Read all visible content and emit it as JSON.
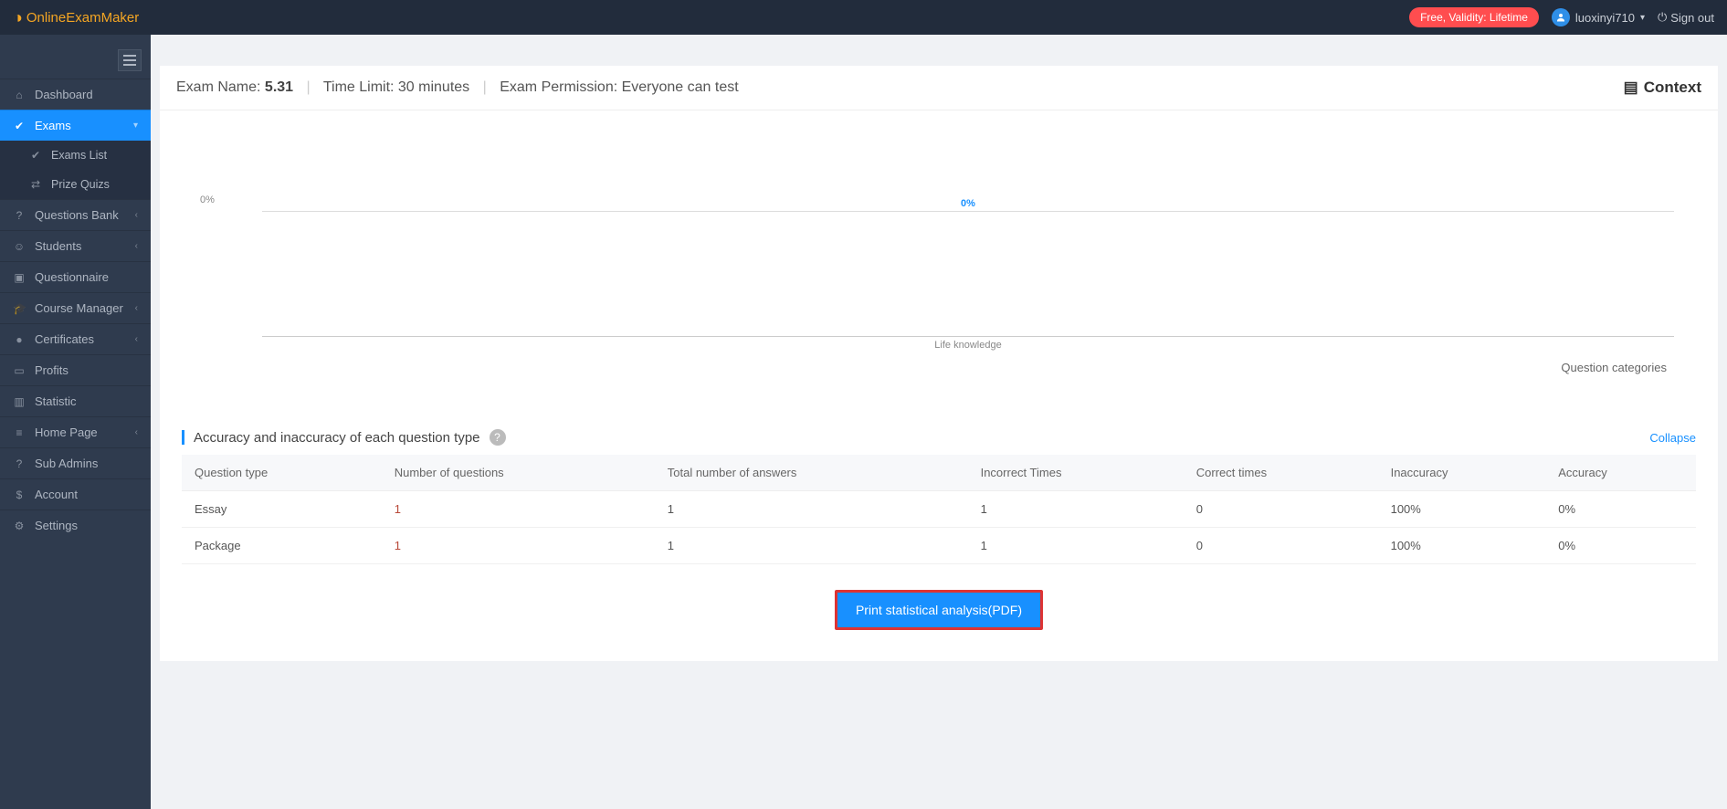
{
  "topbar": {
    "logo_text": "OnlineExamMaker",
    "badge": "Free, Validity: Lifetime",
    "username": "luoxinyi710",
    "signout": "Sign out"
  },
  "sidebar": {
    "items": [
      {
        "label": "Dashboard"
      },
      {
        "label": "Exams"
      },
      {
        "label": "Questions Bank"
      },
      {
        "label": "Students"
      },
      {
        "label": "Questionnaire"
      },
      {
        "label": "Course Manager"
      },
      {
        "label": "Certificates"
      },
      {
        "label": "Profits"
      },
      {
        "label": "Statistic"
      },
      {
        "label": "Home Page"
      },
      {
        "label": "Sub Admins"
      },
      {
        "label": "Account"
      },
      {
        "label": "Settings"
      }
    ],
    "exams_sub": [
      {
        "label": "Exams List"
      },
      {
        "label": "Prize Quizs"
      }
    ]
  },
  "header": {
    "exam_name_label": "Exam Name: ",
    "exam_name_value": "5.31",
    "time_limit": "Time Limit: 30 minutes",
    "permission": "Exam Permission: Everyone can test",
    "context": "Context"
  },
  "chart_data": {
    "type": "bar",
    "categories": [
      "Life knowledge"
    ],
    "values": [
      0
    ],
    "value_labels": [
      "0%"
    ],
    "y_tick": "0%",
    "xlabel": "Question categories"
  },
  "section": {
    "title": "Accuracy and inaccuracy of each question type",
    "collapse": "Collapse"
  },
  "table": {
    "columns": [
      "Question type",
      "Number of questions",
      "Total number of answers",
      "Incorrect Times",
      "Correct times",
      "Inaccuracy",
      "Accuracy"
    ],
    "rows": [
      {
        "type": "Essay",
        "num_q": "1",
        "total_ans": "1",
        "incorrect": "1",
        "correct": "0",
        "inaccuracy": "100%",
        "accuracy": "0%"
      },
      {
        "type": "Package",
        "num_q": "1",
        "total_ans": "1",
        "incorrect": "1",
        "correct": "0",
        "inaccuracy": "100%",
        "accuracy": "0%"
      }
    ]
  },
  "print_button": "Print statistical analysis(PDF)"
}
